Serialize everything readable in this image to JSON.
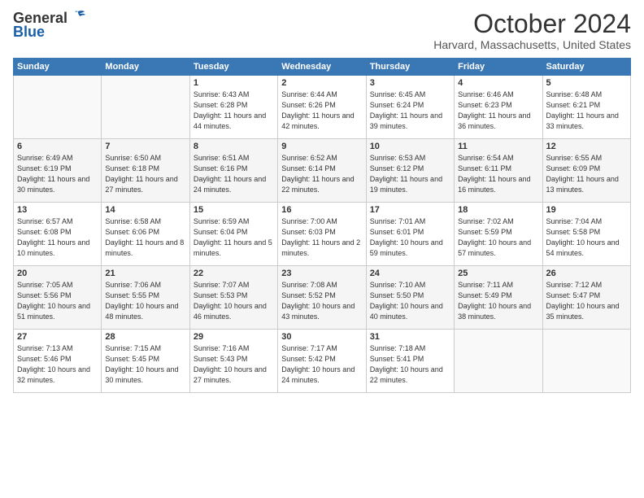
{
  "header": {
    "logo_general": "General",
    "logo_blue": "Blue",
    "month": "October 2024",
    "location": "Harvard, Massachusetts, United States"
  },
  "weekdays": [
    "Sunday",
    "Monday",
    "Tuesday",
    "Wednesday",
    "Thursday",
    "Friday",
    "Saturday"
  ],
  "weeks": [
    [
      {
        "day": "",
        "info": ""
      },
      {
        "day": "",
        "info": ""
      },
      {
        "day": "1",
        "info": "Sunrise: 6:43 AM\nSunset: 6:28 PM\nDaylight: 11 hours\nand 44 minutes."
      },
      {
        "day": "2",
        "info": "Sunrise: 6:44 AM\nSunset: 6:26 PM\nDaylight: 11 hours\nand 42 minutes."
      },
      {
        "day": "3",
        "info": "Sunrise: 6:45 AM\nSunset: 6:24 PM\nDaylight: 11 hours\nand 39 minutes."
      },
      {
        "day": "4",
        "info": "Sunrise: 6:46 AM\nSunset: 6:23 PM\nDaylight: 11 hours\nand 36 minutes."
      },
      {
        "day": "5",
        "info": "Sunrise: 6:48 AM\nSunset: 6:21 PM\nDaylight: 11 hours\nand 33 minutes."
      }
    ],
    [
      {
        "day": "6",
        "info": "Sunrise: 6:49 AM\nSunset: 6:19 PM\nDaylight: 11 hours\nand 30 minutes."
      },
      {
        "day": "7",
        "info": "Sunrise: 6:50 AM\nSunset: 6:18 PM\nDaylight: 11 hours\nand 27 minutes."
      },
      {
        "day": "8",
        "info": "Sunrise: 6:51 AM\nSunset: 6:16 PM\nDaylight: 11 hours\nand 24 minutes."
      },
      {
        "day": "9",
        "info": "Sunrise: 6:52 AM\nSunset: 6:14 PM\nDaylight: 11 hours\nand 22 minutes."
      },
      {
        "day": "10",
        "info": "Sunrise: 6:53 AM\nSunset: 6:12 PM\nDaylight: 11 hours\nand 19 minutes."
      },
      {
        "day": "11",
        "info": "Sunrise: 6:54 AM\nSunset: 6:11 PM\nDaylight: 11 hours\nand 16 minutes."
      },
      {
        "day": "12",
        "info": "Sunrise: 6:55 AM\nSunset: 6:09 PM\nDaylight: 11 hours\nand 13 minutes."
      }
    ],
    [
      {
        "day": "13",
        "info": "Sunrise: 6:57 AM\nSunset: 6:08 PM\nDaylight: 11 hours\nand 10 minutes."
      },
      {
        "day": "14",
        "info": "Sunrise: 6:58 AM\nSunset: 6:06 PM\nDaylight: 11 hours\nand 8 minutes."
      },
      {
        "day": "15",
        "info": "Sunrise: 6:59 AM\nSunset: 6:04 PM\nDaylight: 11 hours\nand 5 minutes."
      },
      {
        "day": "16",
        "info": "Sunrise: 7:00 AM\nSunset: 6:03 PM\nDaylight: 11 hours\nand 2 minutes."
      },
      {
        "day": "17",
        "info": "Sunrise: 7:01 AM\nSunset: 6:01 PM\nDaylight: 10 hours\nand 59 minutes."
      },
      {
        "day": "18",
        "info": "Sunrise: 7:02 AM\nSunset: 5:59 PM\nDaylight: 10 hours\nand 57 minutes."
      },
      {
        "day": "19",
        "info": "Sunrise: 7:04 AM\nSunset: 5:58 PM\nDaylight: 10 hours\nand 54 minutes."
      }
    ],
    [
      {
        "day": "20",
        "info": "Sunrise: 7:05 AM\nSunset: 5:56 PM\nDaylight: 10 hours\nand 51 minutes."
      },
      {
        "day": "21",
        "info": "Sunrise: 7:06 AM\nSunset: 5:55 PM\nDaylight: 10 hours\nand 48 minutes."
      },
      {
        "day": "22",
        "info": "Sunrise: 7:07 AM\nSunset: 5:53 PM\nDaylight: 10 hours\nand 46 minutes."
      },
      {
        "day": "23",
        "info": "Sunrise: 7:08 AM\nSunset: 5:52 PM\nDaylight: 10 hours\nand 43 minutes."
      },
      {
        "day": "24",
        "info": "Sunrise: 7:10 AM\nSunset: 5:50 PM\nDaylight: 10 hours\nand 40 minutes."
      },
      {
        "day": "25",
        "info": "Sunrise: 7:11 AM\nSunset: 5:49 PM\nDaylight: 10 hours\nand 38 minutes."
      },
      {
        "day": "26",
        "info": "Sunrise: 7:12 AM\nSunset: 5:47 PM\nDaylight: 10 hours\nand 35 minutes."
      }
    ],
    [
      {
        "day": "27",
        "info": "Sunrise: 7:13 AM\nSunset: 5:46 PM\nDaylight: 10 hours\nand 32 minutes."
      },
      {
        "day": "28",
        "info": "Sunrise: 7:15 AM\nSunset: 5:45 PM\nDaylight: 10 hours\nand 30 minutes."
      },
      {
        "day": "29",
        "info": "Sunrise: 7:16 AM\nSunset: 5:43 PM\nDaylight: 10 hours\nand 27 minutes."
      },
      {
        "day": "30",
        "info": "Sunrise: 7:17 AM\nSunset: 5:42 PM\nDaylight: 10 hours\nand 24 minutes."
      },
      {
        "day": "31",
        "info": "Sunrise: 7:18 AM\nSunset: 5:41 PM\nDaylight: 10 hours\nand 22 minutes."
      },
      {
        "day": "",
        "info": ""
      },
      {
        "day": "",
        "info": ""
      }
    ]
  ]
}
